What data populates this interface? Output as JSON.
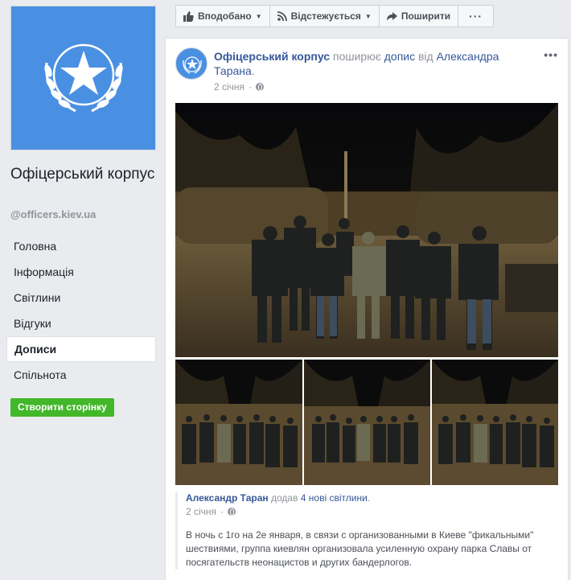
{
  "page": {
    "name": "Офіцерський корпус",
    "handle": "@officers.kiev.ua",
    "brand_color": "#4a90e2"
  },
  "nav": {
    "items": [
      {
        "label": "Головна"
      },
      {
        "label": "Інформація"
      },
      {
        "label": "Світлини"
      },
      {
        "label": "Відгуки"
      },
      {
        "label": "Дописи",
        "active": true
      },
      {
        "label": "Спільнота"
      }
    ],
    "create_page_label": "Створити сторінку"
  },
  "actions": {
    "liked_label": "Вподобано",
    "following_label": "Відстежується",
    "share_label": "Поширити",
    "more_label": "···"
  },
  "post": {
    "author": "Офіцерський корпус",
    "verb": "поширює",
    "object": "допис",
    "from": "від",
    "source_author": "Александра Тарана",
    "timestamp": "2 січня",
    "shared": {
      "author": "Александр Таран",
      "verb": "додав",
      "count_text": "4 нові світлини",
      "timestamp": "2 січня",
      "text": "В ночь с 1го на 2е января, в связи с организованными в Киеве \"фикальными\" шествиями, группа киевлян организовала усиленную охрану парка Славы от посягательств неонацистов и других бандерлогов."
    }
  }
}
